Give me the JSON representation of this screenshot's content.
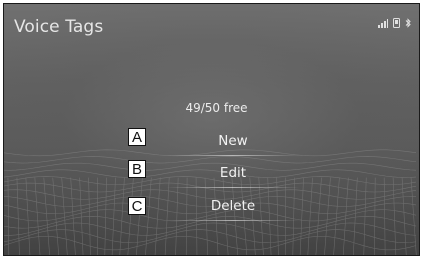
{
  "screen": {
    "title": "Voice Tags",
    "status_icons": [
      "signal-bars-icon",
      "phone-icon",
      "bluetooth-icon"
    ]
  },
  "voice_tags": {
    "free_count": "49/50 free",
    "items": [
      {
        "label": "New",
        "callout": "A"
      },
      {
        "label": "Edit",
        "callout": "B"
      },
      {
        "label": "Delete",
        "callout": "C"
      }
    ]
  },
  "colors": {
    "background": "#626262",
    "text": "#ffffff",
    "callout_fill": "#ffffff",
    "callout_border": "#111111"
  }
}
